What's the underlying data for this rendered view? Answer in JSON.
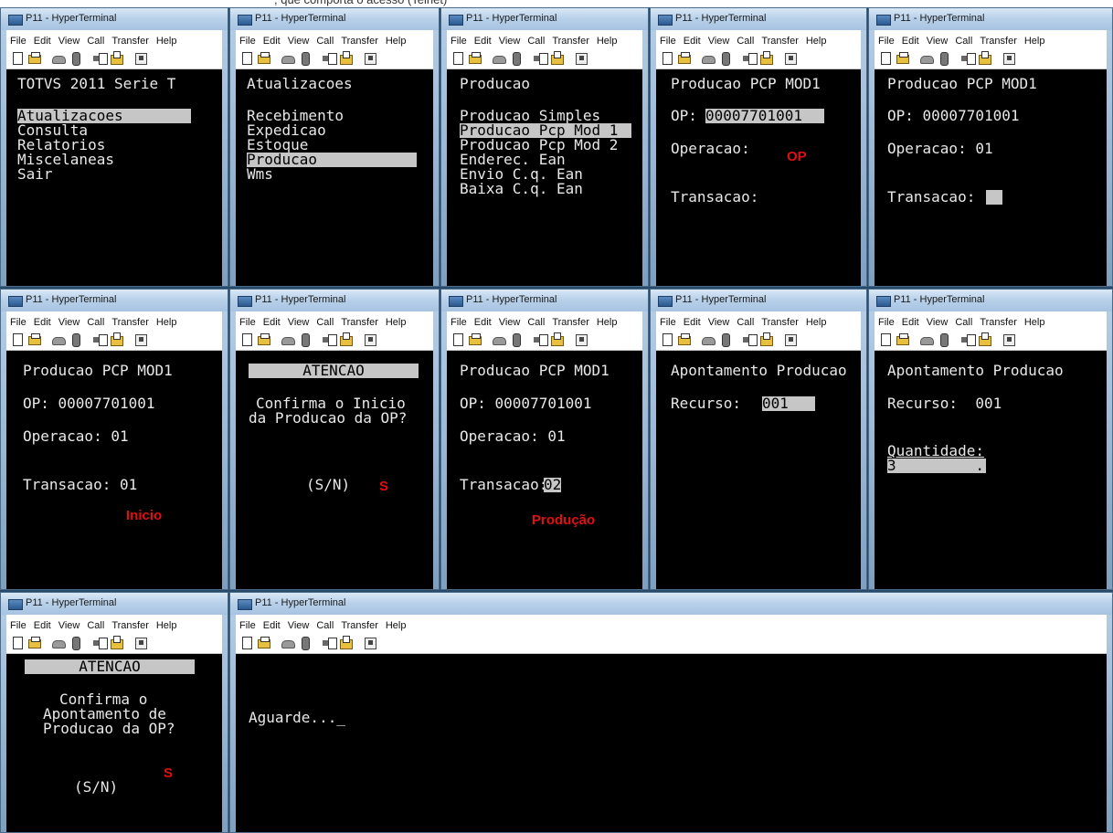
{
  "window_title": "P11 - HyperTerminal",
  "menu": [
    "File",
    "Edit",
    "View",
    "Call",
    "Transfer",
    "Help"
  ],
  "screens": {
    "s1": {
      "l1": "TOTVS 2011 Serie T",
      "l2": "Atualizacoes",
      "l3": "Consulta",
      "l4": "Relatorios",
      "l5": "Miscelaneas",
      "l6": "Sair"
    },
    "s2": {
      "l1": "Atualizacoes",
      "l2": "Recebimento",
      "l3": "Expedicao",
      "l4": "Estoque",
      "l5": "Producao",
      "l6": "Wms"
    },
    "s3": {
      "l1": "Producao",
      "l2": "Producao Simples",
      "l3": "Producao Pcp Mod 1",
      "l4": "Producao Pcp Mod 2",
      "l5": "Enderec. Ean",
      "l6": "Envio C.q. Ean",
      "l7": "Baixa C.q. Ean"
    },
    "s4": {
      "l1": "Producao PCP MOD1",
      "op_label": "OP:",
      "op_value": "00007701001",
      "oper": "Operacao:",
      "trans": "Transacao:",
      "ann": "OP"
    },
    "s5": {
      "l1": "Producao PCP MOD1",
      "op": "OP: 00007701001",
      "oper": "Operacao: 01",
      "trans": "Transacao:"
    },
    "s6": {
      "l1": "Producao PCP MOD1",
      "op": "OP: 00007701001",
      "oper": "Operacao: 01",
      "trans": "Transacao: 01",
      "ann": "Inicio"
    },
    "s7": {
      "l1": "ATENCAO",
      "l2": "Confirma o Inicio",
      "l3": "da Producao da OP?",
      "l4": "(S/N)",
      "ann": "S"
    },
    "s8": {
      "l1": "Producao PCP MOD1",
      "op": "OP: 00007701001",
      "oper": "Operacao: 01",
      "trans": "Transacao:",
      "trans_value": "02",
      "ann": "Produção"
    },
    "s9": {
      "l1": "Apontamento Producao",
      "rec_label": "Recurso:",
      "rec_value": "001"
    },
    "s10": {
      "l1": "Apontamento Producao",
      "rec": "Recurso:  001",
      "qty_label": "Quantidade:",
      "qty_value": "3_        ."
    },
    "s11": {
      "l1": "ATENCAO",
      "l2": "Confirma o",
      "l3": "Apontamento de",
      "l4": "Producao da OP?",
      "l5": "(S/N)",
      "ann": "S"
    },
    "s12": {
      "l1": "Aguarde..._"
    }
  }
}
